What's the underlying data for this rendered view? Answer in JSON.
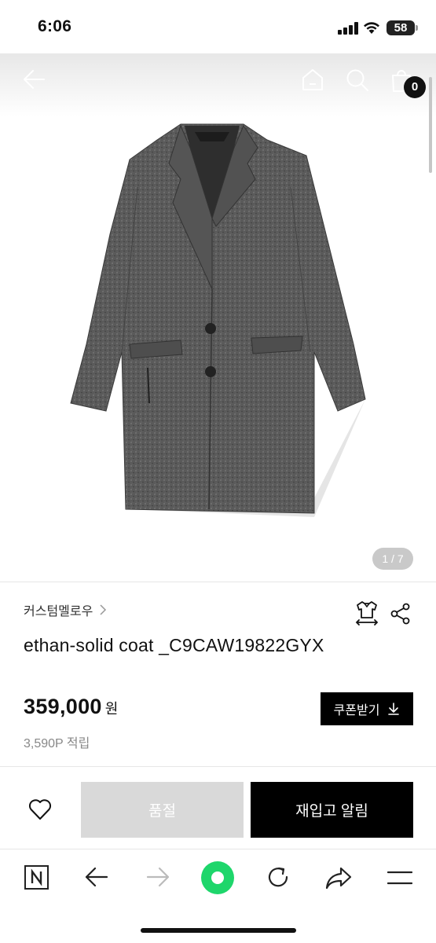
{
  "status_bar": {
    "time": "6:06",
    "battery": "58"
  },
  "header": {
    "cart_count": "0"
  },
  "gallery": {
    "counter": "1 / 7"
  },
  "product": {
    "brand": "커스텀멜로우",
    "name": "ethan-solid coat _C9CAW19822GYX",
    "price": "359,000",
    "currency": "원",
    "points": "3,590P 적립",
    "coupon_label": "쿠폰받기"
  },
  "actions": {
    "sold_out_label": "품절",
    "restock_label": "재입고 알림"
  },
  "browser_toolbar": {
    "items": [
      "naver-home-icon",
      "back-icon",
      "forward-icon",
      "green-dot-icon",
      "reload-icon",
      "share-icon",
      "menu-icon"
    ]
  },
  "colors": {
    "accent_green": "#1ed66b",
    "black": "#000000",
    "soldout_gray": "#d9d9d9"
  }
}
